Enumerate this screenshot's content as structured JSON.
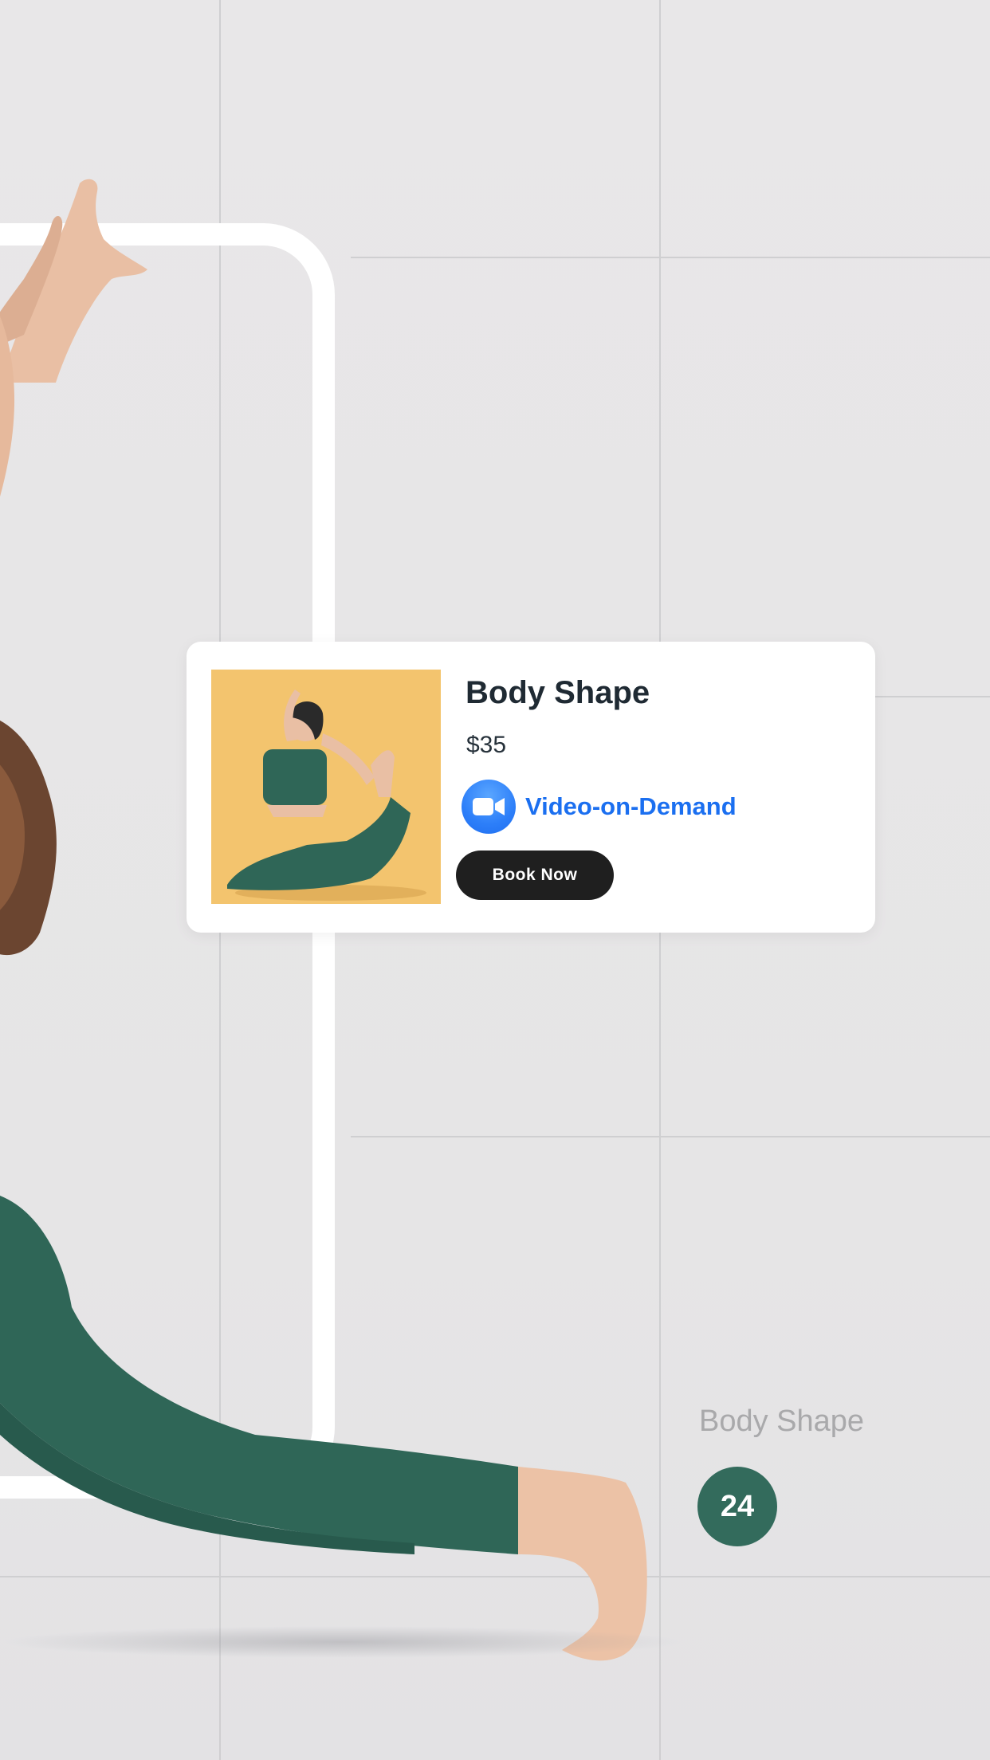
{
  "card": {
    "title": "Body Shape",
    "price": "$35",
    "service_type": "Video-on-Demand",
    "service_icon": "video-camera-icon",
    "book_label": "Book Now",
    "image_subject": "yoga-pose-photo"
  },
  "side": {
    "caption": "Body Shape",
    "badge_count": "24"
  },
  "colors": {
    "background": "#e7e6e7",
    "accent_blue": "#1b6ff0",
    "badge_green": "#336b5c",
    "button_dark": "#1f1f1f",
    "card_image_bg": "#f3c46e",
    "leggings_green": "#2f6657"
  }
}
